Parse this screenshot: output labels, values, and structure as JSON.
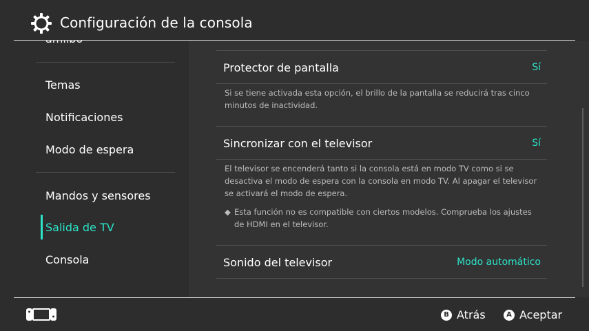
{
  "header": {
    "title": "Configuración de la consola",
    "icon": "gear-icon"
  },
  "sidebar": {
    "items": [
      {
        "label": "amiibo",
        "active": false
      },
      {
        "label": "Temas",
        "active": false
      },
      {
        "label": "Notificaciones",
        "active": false
      },
      {
        "label": "Modo de espera",
        "active": false
      },
      {
        "label": "Mandos y sensores",
        "active": false
      },
      {
        "label": "Salida de TV",
        "active": true
      },
      {
        "label": "Consola",
        "active": false
      }
    ]
  },
  "content": {
    "rows": [
      {
        "label": "Protector de pantalla",
        "value": "Sí",
        "description": "Si se tiene activada esta opción, el brillo de la pantalla se reducirá tras cinco minutos de inactividad."
      },
      {
        "label": "Sincronizar con el televisor",
        "value": "Sí",
        "description": "El televisor se encenderá tanto si la consola está en modo TV como si se desactiva el modo de espera con la consola en modo TV. Al apagar el televisor se activará el modo de espera.",
        "note": "Esta función no es compatible con ciertos modelos. Comprueba los ajustes de HDMI en el televisor."
      },
      {
        "label": "Sonido del televisor",
        "value": "Modo automático"
      }
    ]
  },
  "footer": {
    "back": {
      "button": "B",
      "label": "Atrás"
    },
    "accept": {
      "button": "A",
      "label": "Aceptar"
    }
  },
  "colors": {
    "accent": "#2be4c9",
    "background": "#2d2d2d",
    "panel": "#333333"
  }
}
